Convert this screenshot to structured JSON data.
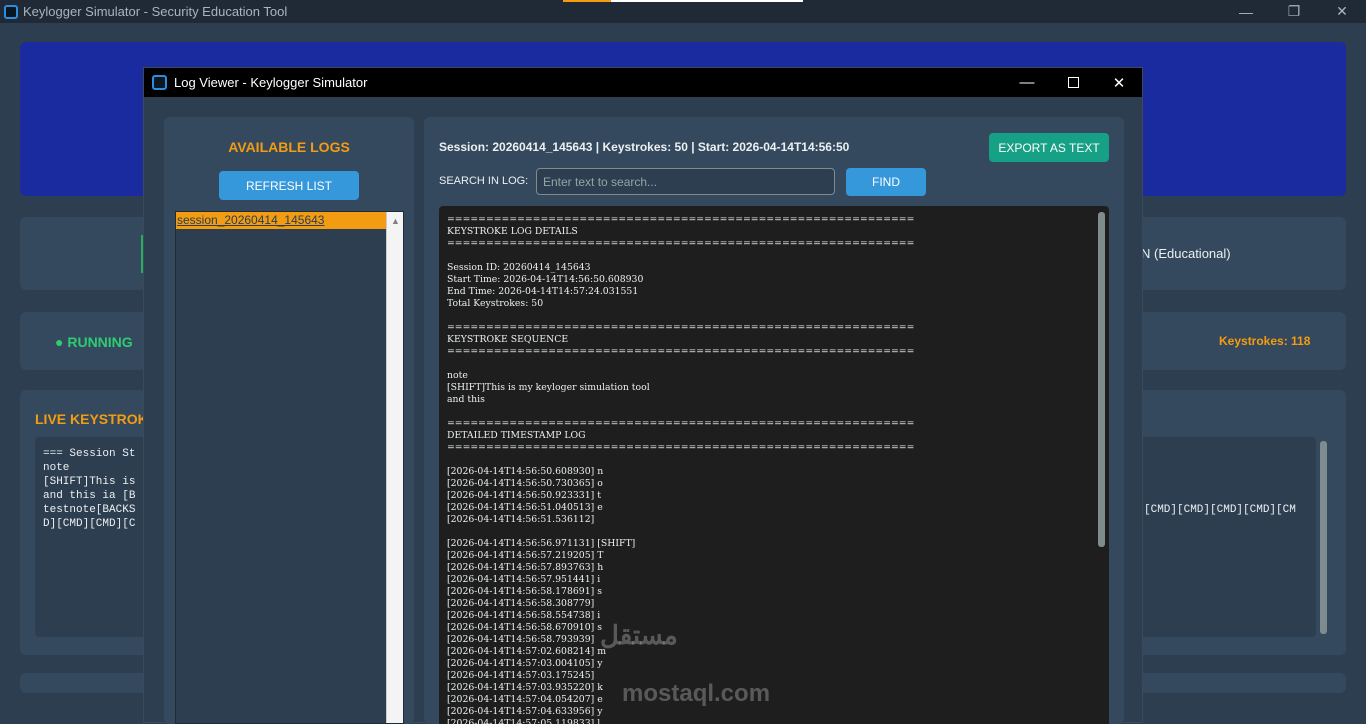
{
  "main_window": {
    "title": "Keylogger Simulator - Security Education Tool",
    "minimize": "—",
    "restore": "❐",
    "close": "✕",
    "mode_text": "N (Educational)",
    "status": "● RUNNING",
    "keystrokes": "Keystrokes: 118",
    "live_title": "LIVE KEYSTROK",
    "live_text": "=== Session St\nnote\n[SHIFT]This is\nand this ia [B\ntestnote[BACKS\nD][CMD][CMD][C",
    "live_text_right": "[CMD][CMD][CMD][CMD][CM"
  },
  "dialog": {
    "title": "Log Viewer - Keylogger Simulator",
    "minimize": "—",
    "close": "✕",
    "available_logs_title": "AVAILABLE LOGS",
    "refresh_label": "REFRESH LIST",
    "log_items": [
      "session_20260414_145643"
    ],
    "scroll_up": "▲",
    "session_info": "Session: 20260414_145643 | Keystrokes: 50 | Start: 2026-04-14T14:56:50",
    "export_label": "EXPORT AS TEXT",
    "search_label": "SEARCH IN LOG:",
    "search_placeholder": "Enter text to search...",
    "find_label": "FIND",
    "log_content": "============================================================\nKEYSTROKE LOG DETAILS\n============================================================\n\nSession ID: 20260414_145643\nStart Time: 2026-04-14T14:56:50.608930\nEnd Time: 2026-04-14T14:57:24.031551\nTotal Keystrokes: 50\n\n============================================================\nKEYSTROKE SEQUENCE\n============================================================\n\nnote\n[SHIFT]This is my keyloger simulation tool\nand this\n\n============================================================\nDETAILED TIMESTAMP LOG\n============================================================\n\n[2026-04-14T14:56:50.608930] n\n[2026-04-14T14:56:50.730365] o\n[2026-04-14T14:56:50.923331] t\n[2026-04-14T14:56:51.040513] e\n[2026-04-14T14:56:51.536112]\n\n[2026-04-14T14:56:56.971131] [SHIFT]\n[2026-04-14T14:56:57.219205] T\n[2026-04-14T14:56:57.893763] h\n[2026-04-14T14:56:57.951441] i\n[2026-04-14T14:56:58.178691] s\n[2026-04-14T14:56:58.308779]\n[2026-04-14T14:56:58.554738] i\n[2026-04-14T14:56:58.670910] s\n[2026-04-14T14:56:58.793939]\n[2026-04-14T14:57:02.608214] m\n[2026-04-14T14:57:03.004105] y\n[2026-04-14T14:57:03.175245]\n[2026-04-14T14:57:03.935220] k\n[2026-04-14T14:57:04.054207] e\n[2026-04-14T14:57:04.633956] y\n[2026-04-14T14:57:05.119833] l"
  },
  "watermark": {
    "arabic": "مستقل",
    "latin": "mostaql.com"
  }
}
